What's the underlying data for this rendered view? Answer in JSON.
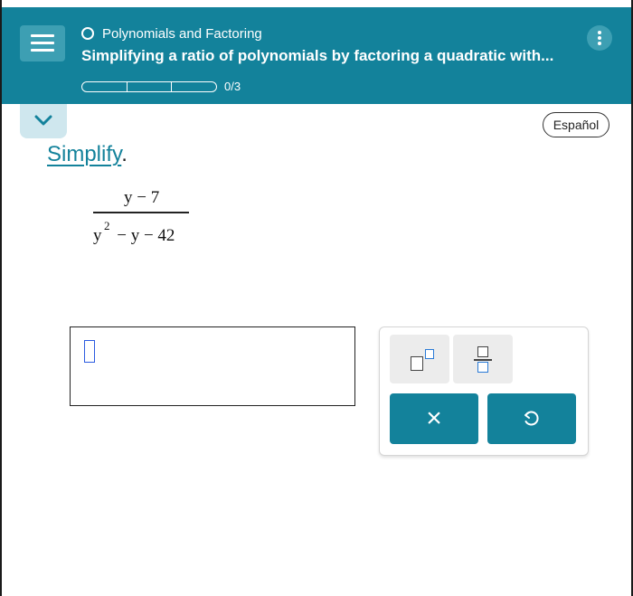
{
  "header": {
    "topic": "Polynomials and Factoring",
    "lesson_title": "Simplifying a ratio of polynomials by factoring a quadratic with...",
    "progress": {
      "completed": 0,
      "total": 3,
      "label": "0/3"
    },
    "background_color": "#13829b"
  },
  "language_button": {
    "label": "Español"
  },
  "instruction": {
    "word": "Simplify",
    "punctuation": "."
  },
  "problem": {
    "numerator": "y − 7",
    "denominator": {
      "base": "y",
      "exponent": "2",
      "rest": " − y − 42"
    }
  },
  "answer": {
    "value": ""
  },
  "toolbox": {
    "buttons": [
      {
        "name": "exponent",
        "icon": "superscript-template-icon"
      },
      {
        "name": "fraction",
        "icon": "fraction-template-icon"
      },
      {
        "name": "clear",
        "label": "×"
      },
      {
        "name": "undo",
        "label": "↺"
      }
    ],
    "accent_color": "#13829b"
  }
}
